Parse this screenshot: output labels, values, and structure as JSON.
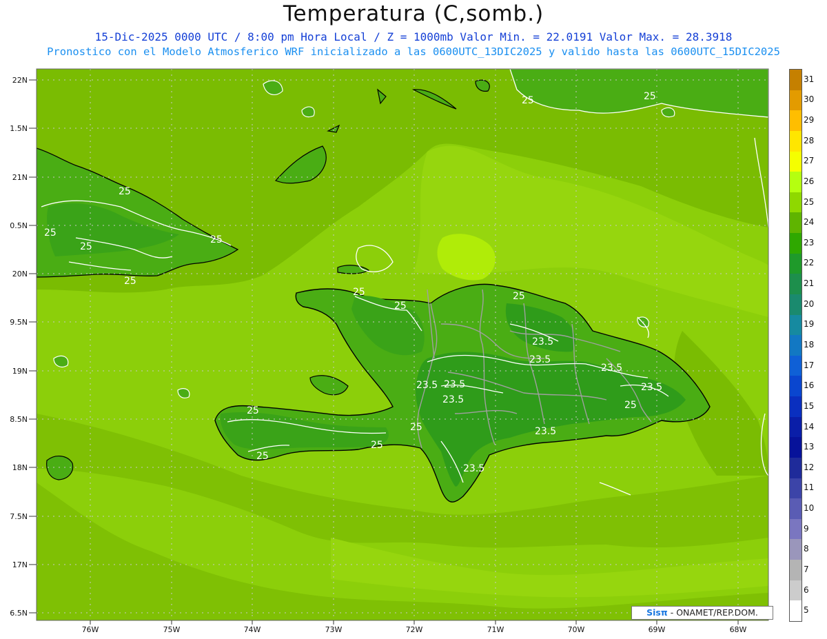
{
  "title": "Temperatura (C,somb.)",
  "subtitle_line1": "15-Dic-2025  0000 UTC / 8:00 pm Hora Local / Z = 1000mb   Valor Min. = 22.0191  Valor Max. = 28.3918",
  "subtitle_line2": "Pronostico con el Modelo Atmosferico WRF inicializado a las 0600UTC_13DIC2025 y valido hasta las  0600UTC_15DIC2025",
  "credit": {
    "logo": "Sisπ",
    "text": "- ONAMET/REP.DOM."
  },
  "y_ticks": [
    "22N",
    "21.5N",
    "21N",
    "20.5N",
    "20N",
    "19.5N",
    "19N",
    "18.5N",
    "18N",
    "17.5N",
    "17N",
    "16.5N"
  ],
  "y_tick_labels": [
    "22N",
    "1.5N",
    "21N",
    "0.5N",
    "20N",
    "9.5N",
    "19N",
    "8.5N",
    "18N",
    "7.5N",
    "17N",
    "6.5N"
  ],
  "x_tick_labels": [
    "76W",
    "75W",
    "74W",
    "73W",
    "72W",
    "71W",
    "70W",
    "69W",
    "68W"
  ],
  "contour_labels": [
    "25",
    "25",
    "25",
    "25",
    "25",
    "25",
    "25",
    "25",
    "25",
    "25",
    "25",
    "25",
    "25",
    "25",
    "23.5",
    "23.5",
    "23.5",
    "23.5",
    "23.5",
    "23.5",
    "23.5",
    "23.5",
    "23.5",
    "25"
  ],
  "colorbar": {
    "labels": [
      "31",
      "30",
      "29",
      "28",
      "27",
      "26",
      "25",
      "24",
      "23",
      "22",
      "21",
      "20",
      "19",
      "18",
      "17",
      "16",
      "15",
      "14",
      "13",
      "12",
      "11",
      "10",
      "9",
      "8",
      "7",
      "6",
      "5"
    ],
    "colors": [
      "#c58000",
      "#e39b00",
      "#ffbe00",
      "#ffe600",
      "#f5ff00",
      "#b5ff10",
      "#8fd800",
      "#5fb400",
      "#2fa800",
      "#1f9a2a",
      "#1d8f4c",
      "#1a8a6e",
      "#168aa0",
      "#1278c3",
      "#0f60d6",
      "#0a46cf",
      "#0a2fbf",
      "#0a1ea8",
      "#07129a",
      "#1f2b9a",
      "#3c44a8",
      "#5a5cb4",
      "#7a76c0",
      "#9a96bb",
      "#b4b4b4",
      "#cccccc",
      "#ffffff"
    ]
  },
  "colors": {
    "sea_base": "#8ccf0a",
    "sea_light": "#9bd812",
    "sea_dark": "#7abc02",
    "land_24": "#4aad14",
    "land_23": "#2f9c1a",
    "peak_27": "#b7f008",
    "coast": "#000000",
    "borders": "#9a9a9a",
    "grid": "#b8b8b8"
  }
}
